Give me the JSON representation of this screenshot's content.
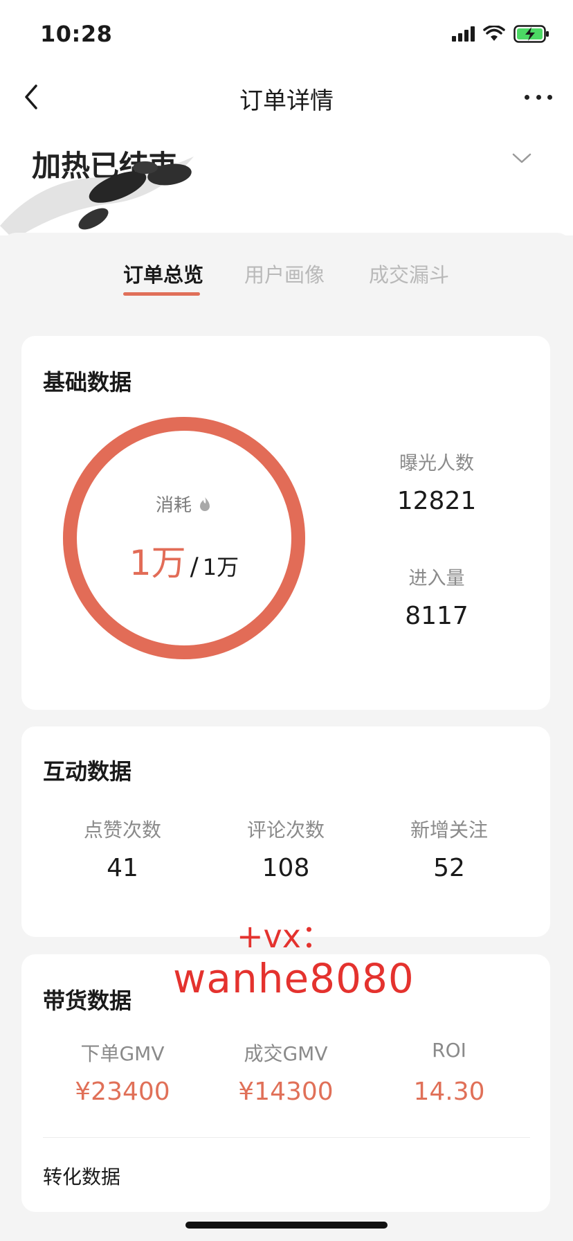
{
  "status_bar": {
    "time": "10:28"
  },
  "nav": {
    "title": "订单详情"
  },
  "order_status": {
    "title": "加热已结束"
  },
  "tabs": [
    {
      "label": "订单总览",
      "active": true
    },
    {
      "label": "用户画像",
      "active": false
    },
    {
      "label": "成交漏斗",
      "active": false
    }
  ],
  "basic": {
    "title": "基础数据",
    "spend_label": "消耗",
    "spend_value": "1万",
    "spend_separator": "/",
    "spend_total": "1万",
    "spend_progress": 1.0,
    "exposure_label": "曝光人数",
    "exposure_value": "12821",
    "entry_label": "进入量",
    "entry_value": "8117"
  },
  "interaction": {
    "title": "互动数据",
    "items": [
      {
        "label": "点赞次数",
        "value": "41"
      },
      {
        "label": "评论次数",
        "value": "108"
      },
      {
        "label": "新增关注",
        "value": "52"
      }
    ]
  },
  "sales": {
    "title": "带货数据",
    "items": [
      {
        "label": "下单GMV",
        "value": "¥23400"
      },
      {
        "label": "成交GMV",
        "value": "¥14300"
      },
      {
        "label": "ROI",
        "value": "14.30"
      }
    ],
    "conversion_title": "转化数据"
  },
  "watermark": {
    "line1": "+vx：",
    "line2": "wanhe8080"
  },
  "colors": {
    "accent": "#e26c57",
    "background": "#f4f4f4",
    "card": "#ffffff",
    "watermark": "#e4322e"
  }
}
